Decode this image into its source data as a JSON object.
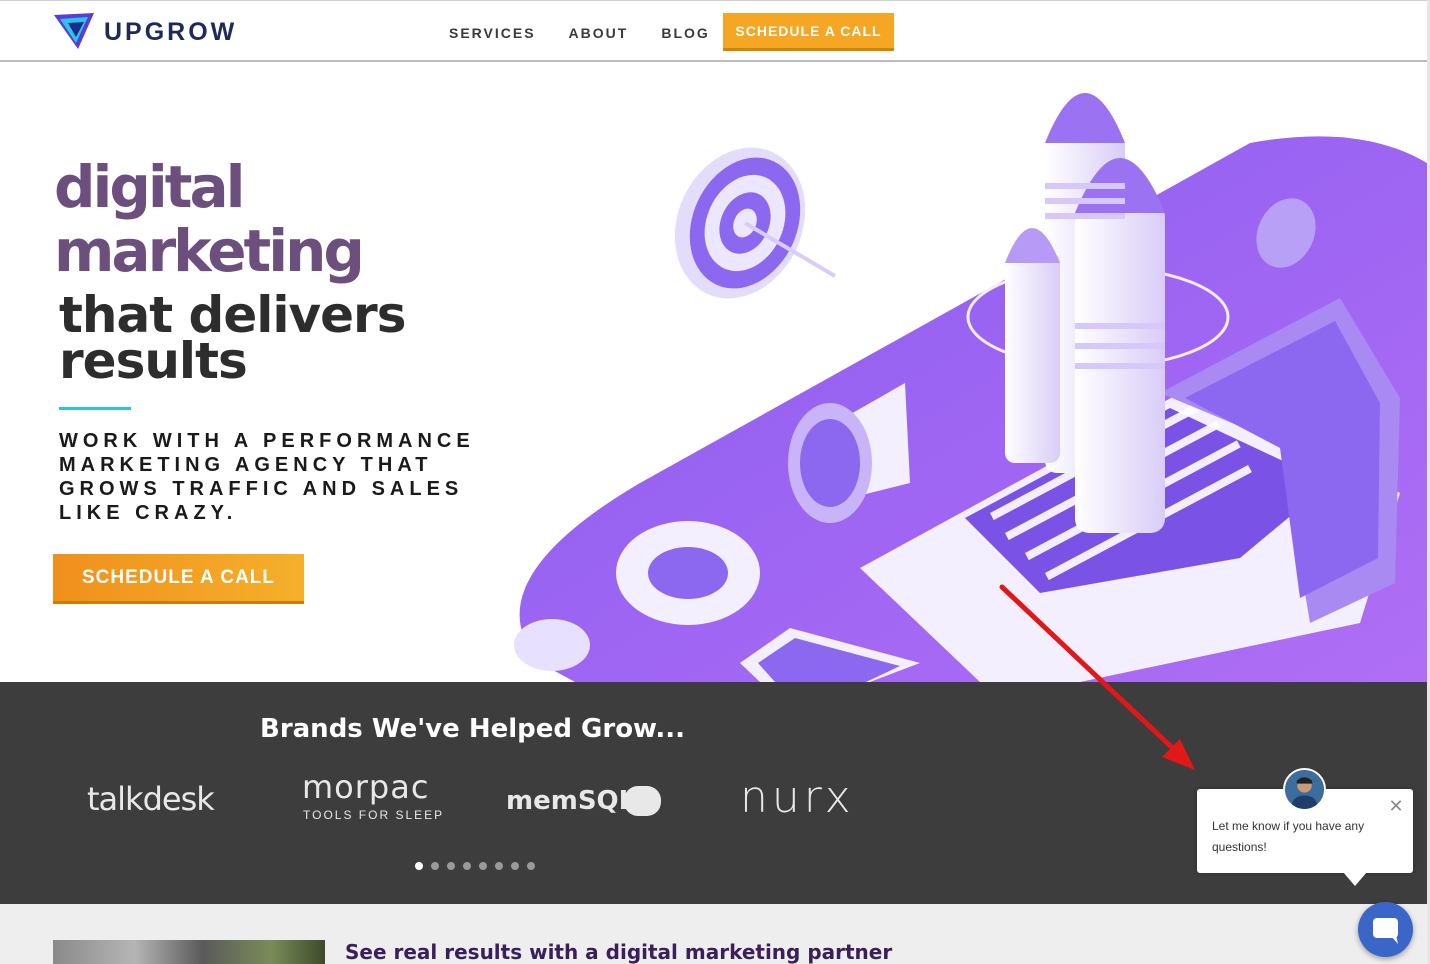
{
  "header": {
    "logo_text": "UPGROW",
    "nav": [
      "SERVICES",
      "ABOUT",
      "BLOG"
    ],
    "cta_label": "SCHEDULE A CALL"
  },
  "hero": {
    "line1": "digital",
    "line2": "marketing",
    "line3": "that delivers",
    "line4": "results",
    "tagline": "WORK WITH A PERFORMANCE MARKETING AGENCY THAT GROWS TRAFFIC AND SALES LIKE CRAZY.",
    "cta_label": "SCHEDULE A CALL"
  },
  "brands": {
    "title": "Brands We've Helped Grow...",
    "logos": {
      "talkdesk": "talkdesk",
      "morpac": "morpac",
      "morpac_sub": "TOOLS FOR SLEEP",
      "memsql": "memSQL",
      "nurx": "nurx"
    },
    "carousel_dots": 8,
    "active_dot": 1
  },
  "results": {
    "title": "See real results with a digital marketing partner"
  },
  "chat": {
    "message": "Let me know if you have any questions!",
    "close_symbol": "✕"
  },
  "colors": {
    "accent_orange": "#f5a623",
    "hero_purple": "#6d4f7e",
    "teal": "#2ac4d4",
    "brands_bg": "#3d3d3d",
    "chat_blue": "#3a66c8"
  }
}
